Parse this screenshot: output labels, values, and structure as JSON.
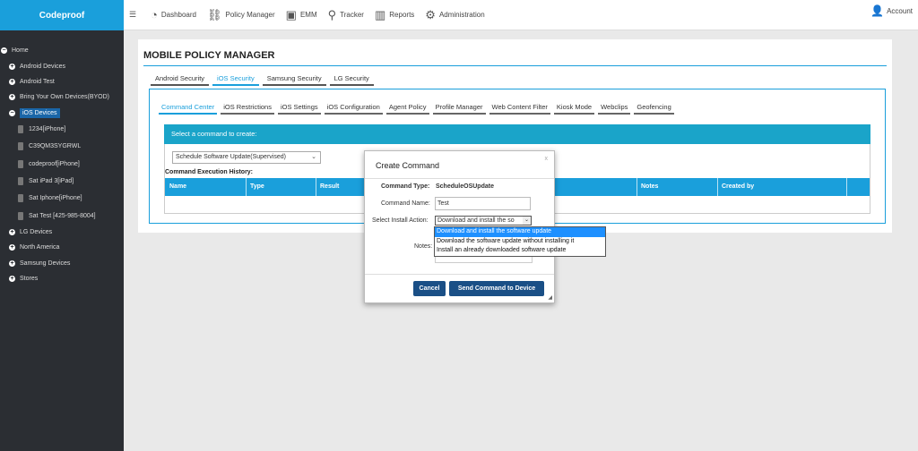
{
  "app": {
    "brand": "Codeproof"
  },
  "topnav": {
    "items": [
      {
        "label": "Dashboard",
        "icon": "dashboard-icon"
      },
      {
        "label": "Policy Manager",
        "icon": "policy-icon"
      },
      {
        "label": "EMM",
        "icon": "emm-icon"
      },
      {
        "label": "Tracker",
        "icon": "map-pin-icon"
      },
      {
        "label": "Reports",
        "icon": "bar-chart-icon"
      },
      {
        "label": "Administration",
        "icon": "gear-icon"
      }
    ],
    "account": "Account"
  },
  "sidebar": {
    "items": [
      {
        "label": "Home"
      },
      {
        "label": "Android Devices"
      },
      {
        "label": "Android Test"
      },
      {
        "label": "Bring Your Own Devices(BYOD)"
      },
      {
        "label": "iOS Devices"
      },
      {
        "label": "1234[iPhone]"
      },
      {
        "label": "C39QM3SYGRWL"
      },
      {
        "label": "codeproof[iPhone]"
      },
      {
        "label": "Sat iPad 3[iPad]"
      },
      {
        "label": "Sat Iphone[iPhone]"
      },
      {
        "label": "Sat Test [425-985-8004]"
      },
      {
        "label": "LG Devices"
      },
      {
        "label": "North America"
      },
      {
        "label": "Samsung Devices"
      },
      {
        "label": "Stores"
      }
    ]
  },
  "main": {
    "title": "MOBILE POLICY MANAGER",
    "section_tabs": [
      "Android Security",
      "iOS Security",
      "Samsung Security",
      "LG Security"
    ],
    "inner_tabs": [
      "Command Center",
      "iOS Restrictions",
      "iOS Settings",
      "iOS Configuration",
      "Agent Policy",
      "Profile Manager",
      "Web Content Filter",
      "Kiosk Mode",
      "Webclips",
      "Geofencing"
    ],
    "command_prompt": "Select a command to create:",
    "command_select": "Schedule Software Update(Supervised)",
    "history_label": "Command Execution History:",
    "history_columns": [
      "Name",
      "Type",
      "Result",
      "Notes",
      "Created by"
    ]
  },
  "modal": {
    "title": "Create Command",
    "close": "x",
    "type_label": "Command Type:",
    "type_value": "ScheduleOSUpdate",
    "name_label": "Command Name:",
    "name_value": "Test",
    "action_label": "Select Install Action:",
    "action_value": "Download and install the so",
    "notes_label": "Notes:",
    "cancel": "Cancel",
    "send": "Send Command to Device",
    "options": [
      "Download and install the software update",
      "Download the software update without installing it",
      "Install an already downloaded software update"
    ]
  }
}
